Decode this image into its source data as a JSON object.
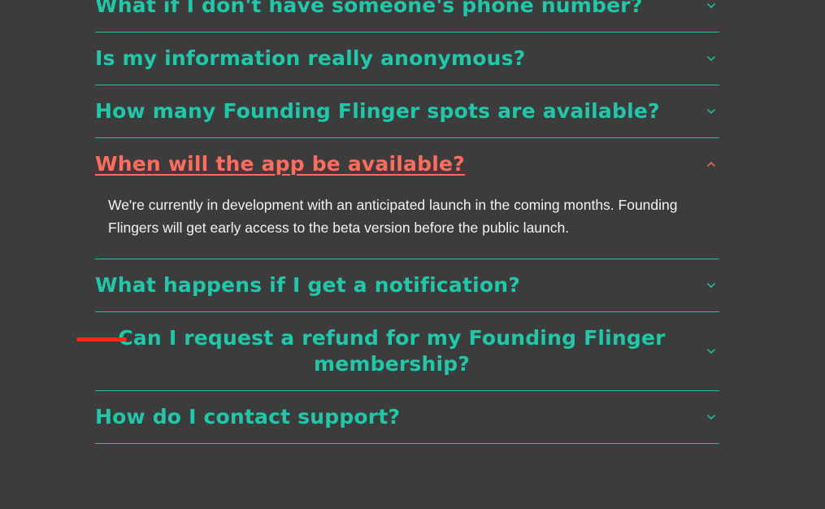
{
  "faq": {
    "items": [
      {
        "question": "What if I don't have someone's phone number?",
        "expanded": false
      },
      {
        "question": "Is my information really anonymous?",
        "expanded": false
      },
      {
        "question": "How many Founding Flinger spots are available?",
        "expanded": false
      },
      {
        "question": "When will the app be available?",
        "expanded": true,
        "answer": "We're currently in development with an anticipated launch in the coming months. Founding Flingers will get early access to the beta version before the public launch."
      },
      {
        "question": "What happens if I get a notification?",
        "expanded": false
      },
      {
        "question": "Can I request a refund for my Founding Flinger membership?",
        "expanded": false
      },
      {
        "question": "How do I contact support?",
        "expanded": false
      }
    ]
  },
  "colors": {
    "background": "#3c3c3c",
    "accent_teal": "#20c7a8",
    "active_coral": "#ff6b5e",
    "annotation_red": "#ff2a14",
    "answer_text": "#f2f2f2"
  },
  "icons": {
    "collapsed": "chevron-down-icon",
    "expanded": "chevron-up-icon"
  }
}
